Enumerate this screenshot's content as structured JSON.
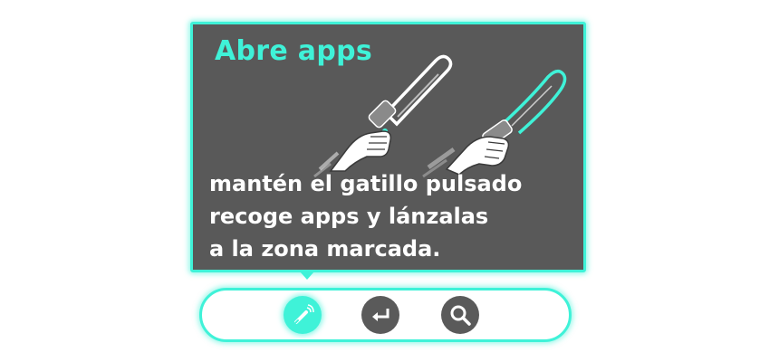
{
  "tutorial": {
    "title": "Abre apps",
    "lines": [
      "mantén el gatillo pulsado",
      "recoge apps y lánzalas",
      "a la zona marcada."
    ],
    "illustration": "two hands holding VR controllers with trigger pressed",
    "colors": {
      "accent": "#3ff2d8",
      "panel_background": "#595959",
      "text": "#ffffff"
    }
  },
  "toolbar": {
    "buttons": [
      {
        "icon": "controller-pointer-icon",
        "state": "active"
      },
      {
        "icon": "return-arrow-icon",
        "state": "inactive"
      },
      {
        "icon": "search-icon",
        "state": "inactive"
      }
    ]
  }
}
